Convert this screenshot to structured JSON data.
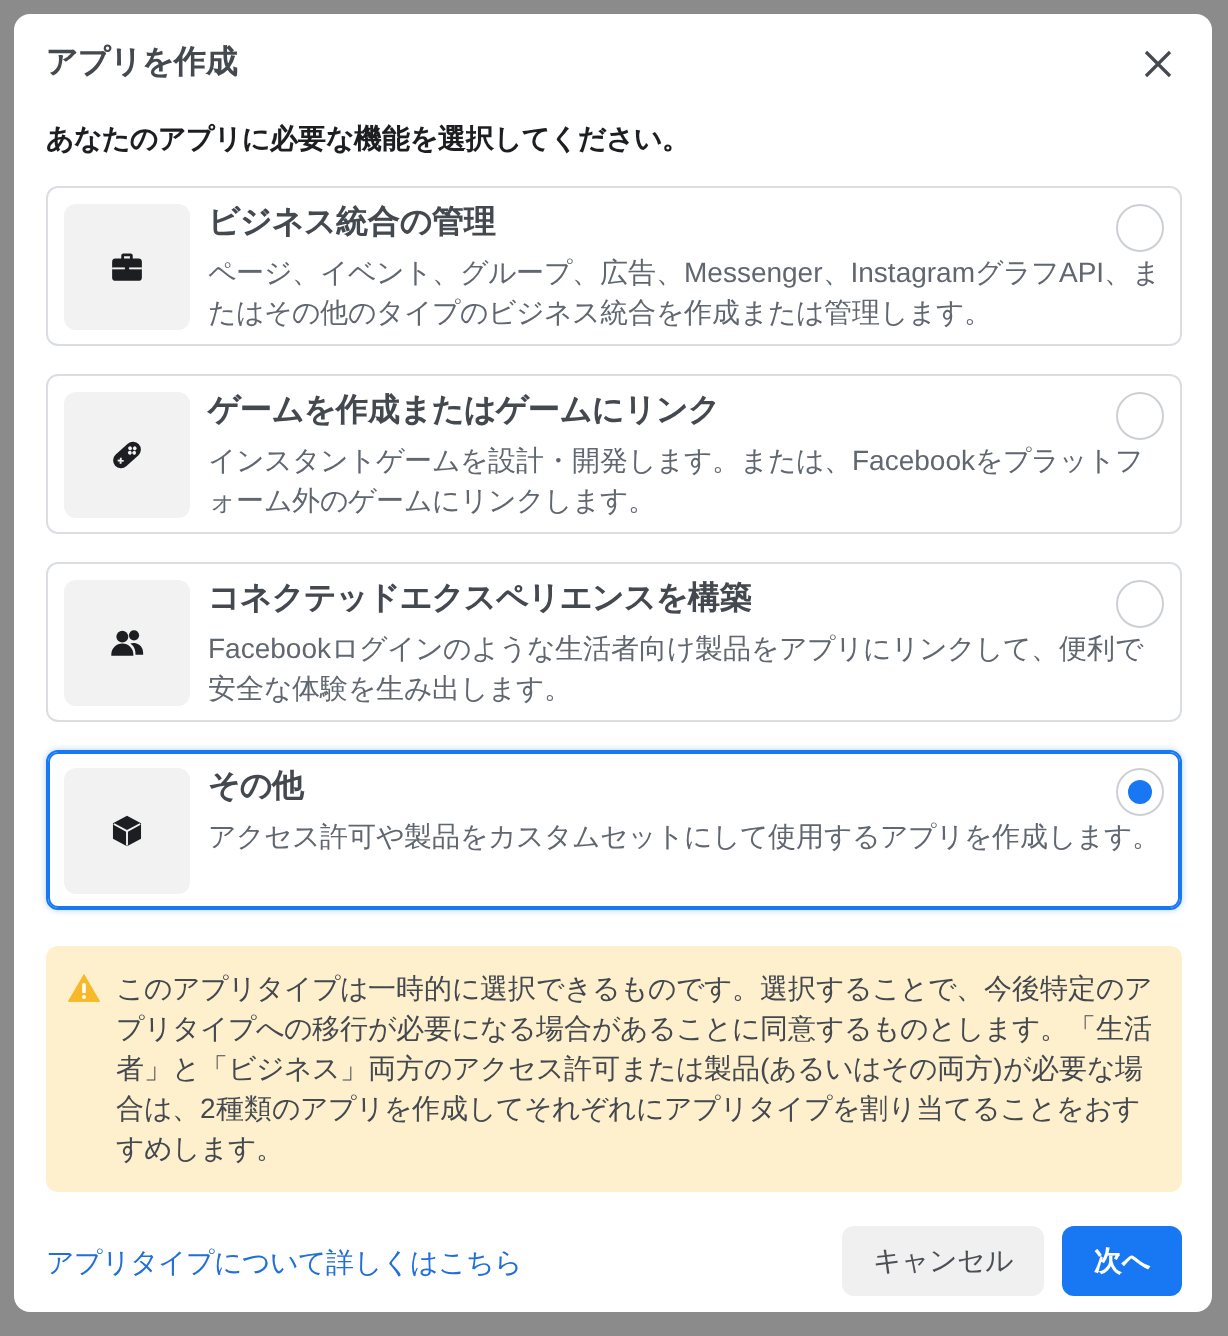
{
  "dialog": {
    "title": "アプリを作成",
    "prompt": "あなたのアプリに必要な機能を選択してください。"
  },
  "options": [
    {
      "title": "ビジネス統合の管理",
      "description": "ページ、イベント、グループ、広告、Messenger、InstagramグラフAPI、またはその他のタイプのビジネス統合を作成または管理します。",
      "selected": false
    },
    {
      "title": "ゲームを作成またはゲームにリンク",
      "description": "インスタントゲームを設計・開発します。または、Facebookをプラットフォーム外のゲームにリンクします。",
      "selected": false
    },
    {
      "title": "コネクテッドエクスペリエンスを構築",
      "description": "Facebookログインのような生活者向け製品をアプリにリンクして、便利で安全な体験を生み出します。",
      "selected": false
    },
    {
      "title": "その他",
      "description": "アクセス許可や製品をカスタムセットにして使用するアプリを作成します。",
      "selected": true
    }
  ],
  "notice": {
    "text": "このアプリタイプは一時的に選択できるものです。選択することで、今後特定のアプリタイプへの移行が必要になる場合があることに同意するものとします。「生活者」と「ビジネス」両方のアクセス許可または製品(あるいはその両方)が必要な場合は、2種類のアプリを作成してそれぞれにアプリタイプを割り当てることをおすすめします。"
  },
  "footer": {
    "link": "アプリタイプについて詳しくはこちら",
    "buttons": [
      {
        "label": "キャンセル",
        "kind": "secondary"
      },
      {
        "label": "次へ",
        "kind": "primary"
      }
    ]
  }
}
